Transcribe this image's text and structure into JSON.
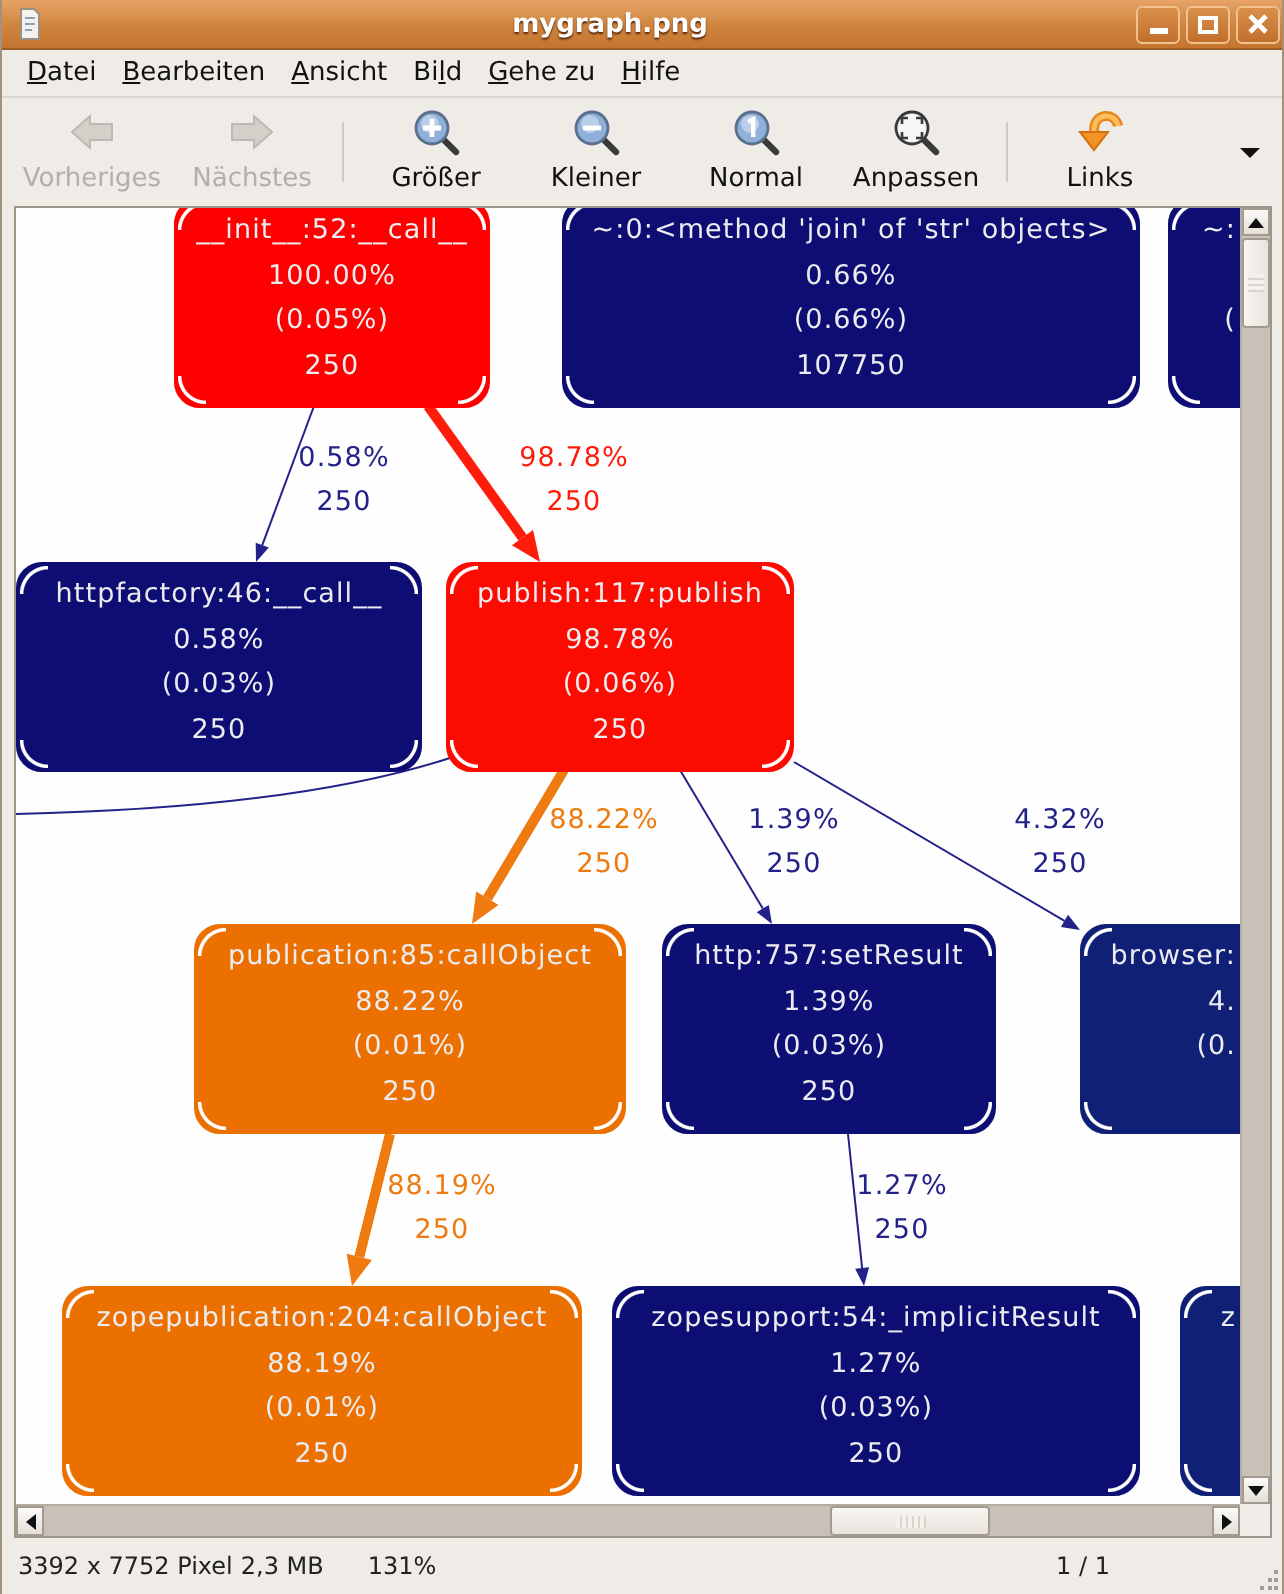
{
  "window": {
    "title": "mygraph.png"
  },
  "menu": [
    {
      "key": "D",
      "after": "atei"
    },
    {
      "key": "B",
      "after": "earbeiten"
    },
    {
      "key": "A",
      "after": "nsicht"
    },
    {
      "before": "Bi",
      "key": "l",
      "after": "d"
    },
    {
      "key": "G",
      "after": "ehe zu"
    },
    {
      "key": "H",
      "after": "ilfe"
    }
  ],
  "toolbar": {
    "groups": [
      [
        {
          "kind": "previous",
          "label": "Vorheriges",
          "disabled": true
        },
        {
          "kind": "next",
          "label": "Nächstes",
          "disabled": true
        }
      ],
      [
        {
          "kind": "enlarge",
          "label": "Größer",
          "disabled": false
        },
        {
          "kind": "shrink",
          "label": "Kleiner",
          "disabled": false
        },
        {
          "kind": "normal",
          "label": "Normal",
          "disabled": false
        },
        {
          "kind": "fit",
          "label": "Anpassen",
          "disabled": false
        }
      ],
      [
        {
          "kind": "rotate",
          "label": "Links",
          "disabled": false
        }
      ]
    ]
  },
  "graph": {
    "nodes": [
      {
        "title": "__init__:52:__call__",
        "total": "100.00%",
        "self": "(0.05%)",
        "calls": "250",
        "color": "#ff0000"
      },
      {
        "title": "~:0:<method 'join' of 'str' objects>",
        "total": "0.66%",
        "self": "(0.66%)",
        "calls": "107750",
        "color": "#0d0d73"
      },
      {
        "title": "~:",
        "self": "(",
        "color": "#0d0d73"
      },
      {
        "title": "httpfactory:46:__call__",
        "total": "0.58%",
        "self": "(0.03%)",
        "calls": "250",
        "color": "#0d0d73"
      },
      {
        "title": "publish:117:publish",
        "total": "98.78%",
        "self": "(0.06%)",
        "calls": "250",
        "color": "#fb0b00"
      },
      {
        "title": "publication:85:callObject",
        "total": "88.22%",
        "self": "(0.01%)",
        "calls": "250",
        "color": "#ec7000"
      },
      {
        "title": "http:757:setResult",
        "total": "1.39%",
        "self": "(0.03%)",
        "calls": "250",
        "color": "#0d0f74"
      },
      {
        "title": "browser:",
        "total": "4.",
        "self": "(0.",
        "color": "#0f2076"
      },
      {
        "title": "zopepublication:204:callObject",
        "total": "88.19%",
        "self": "(0.01%)",
        "calls": "250",
        "color": "#ec7000"
      },
      {
        "title": "zopesupport:54:_implicitResult",
        "total": "1.27%",
        "self": "(0.03%)",
        "calls": "250",
        "color": "#0d0e73"
      },
      {
        "title": "z",
        "color": "#0f2076"
      }
    ],
    "edges": [
      {
        "percent": "0.58%",
        "count": "250",
        "color": "#22228a",
        "kind": "thin"
      },
      {
        "percent": "98.78%",
        "count": "250",
        "color": "#ff1c0a",
        "kind": "thick"
      },
      {
        "color": "#22228a",
        "kind": "thin"
      },
      {
        "percent": "88.22%",
        "count": "250",
        "color": "#ee7a10",
        "kind": "thick"
      },
      {
        "percent": "1.39%",
        "count": "250",
        "color": "#22228a",
        "kind": "thin"
      },
      {
        "percent": "4.32%",
        "count": "250",
        "color": "#22228a",
        "kind": "thin"
      },
      {
        "percent": "88.19%",
        "count": "250",
        "color": "#ee7a10",
        "kind": "thick"
      },
      {
        "percent": "1.27%",
        "count": "250",
        "color": "#22228a",
        "kind": "thin"
      }
    ]
  },
  "status_bar": {
    "dimensions": "3392 x 7752 Pixel",
    "file_size": "2,3 MB",
    "zoom": "131%",
    "page": "1 / 1"
  }
}
